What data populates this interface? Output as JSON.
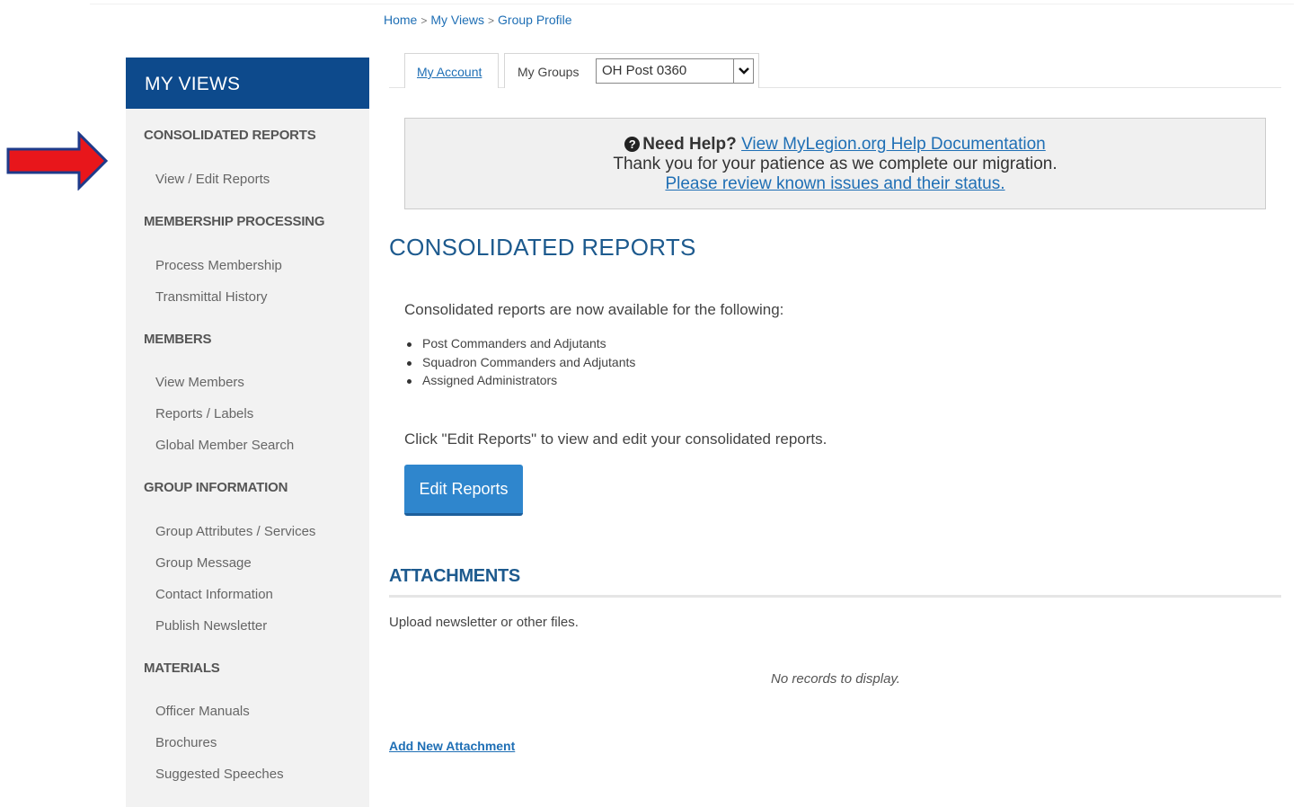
{
  "breadcrumb": {
    "items": [
      "Home",
      "My Views",
      "Group Profile"
    ],
    "separator": ">"
  },
  "sidebar": {
    "title": "MY VIEWS",
    "sections": [
      {
        "label": "CONSOLIDATED REPORTS",
        "items": [
          "View / Edit Reports"
        ]
      },
      {
        "label": "MEMBERSHIP PROCESSING",
        "items": [
          "Process Membership",
          "Transmittal History"
        ]
      },
      {
        "label": "MEMBERS",
        "items": [
          "View Members",
          "Reports / Labels",
          "Global Member Search"
        ]
      },
      {
        "label": "GROUP INFORMATION",
        "items": [
          "Group Attributes / Services",
          "Group Message",
          "Contact Information",
          "Publish Newsletter"
        ]
      },
      {
        "label": "MATERIALS",
        "items": [
          "Officer Manuals",
          "Brochures",
          "Suggested Speeches"
        ]
      }
    ]
  },
  "tabs": {
    "my_account": "My Account",
    "my_groups": "My Groups",
    "group_select_value": "OH Post 0360"
  },
  "help": {
    "need_help": "Need Help?",
    "doc_link": "View MyLegion.org Help Documentation",
    "patience": "Thank you for your patience as we complete our migration.",
    "issues_link": "Please review known issues and their status."
  },
  "main": {
    "title": "CONSOLIDATED REPORTS",
    "intro": "Consolidated reports are now available for the following:",
    "bullets": [
      "Post Commanders and Adjutants",
      "Squadron Commanders and Adjutants",
      "Assigned Administrators"
    ],
    "click_text": "Click \"Edit Reports\" to view and edit your consolidated reports.",
    "edit_button": "Edit Reports"
  },
  "attachments": {
    "title": "ATTACHMENTS",
    "upload_text": "Upload newsletter or other files.",
    "no_records": "No records to display.",
    "add_link": "Add New Attachment"
  },
  "colors": {
    "sidebar_header": "#0d4a8c",
    "link": "#1f6fb5",
    "heading": "#1d5a8e",
    "button": "#2f86cd",
    "arrow_fill": "#e8161b",
    "arrow_stroke": "#1e3a8a"
  }
}
